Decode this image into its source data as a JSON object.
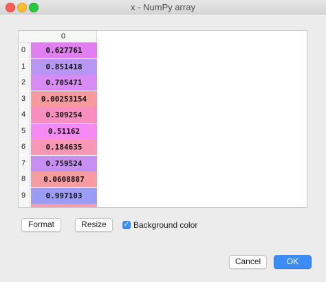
{
  "window": {
    "title": "x - NumPy array"
  },
  "table": {
    "column_header": "0",
    "rows": [
      {
        "index": "0",
        "value": "0.627761",
        "color": "#e080f0"
      },
      {
        "index": "1",
        "value": "0.851418",
        "color": "#b896f3"
      },
      {
        "index": "2",
        "value": "0.705471",
        "color": "#d88cf3"
      },
      {
        "index": "3",
        "value": "0.00253154",
        "color": "#f79a9f"
      },
      {
        "index": "4",
        "value": "0.309254",
        "color": "#f78ebd"
      },
      {
        "index": "5",
        "value": "0.51162",
        "color": "#f58af2"
      },
      {
        "index": "6",
        "value": "0.184635",
        "color": "#f797b4"
      },
      {
        "index": "7",
        "value": "0.759524",
        "color": "#c78ff1"
      },
      {
        "index": "8",
        "value": "0.0608887",
        "color": "#f79ba2"
      },
      {
        "index": "9",
        "value": "0.997103",
        "color": "#9a9cf5"
      },
      {
        "index": "",
        "value": "",
        "color": "#f59bb5"
      }
    ]
  },
  "buttons": {
    "format": "Format",
    "resize": "Resize",
    "cancel": "Cancel",
    "ok": "OK"
  },
  "background_color": {
    "label": "Background color",
    "checked": true
  }
}
